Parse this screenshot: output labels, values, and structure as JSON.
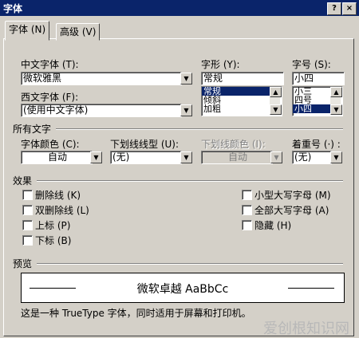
{
  "window": {
    "title": "字体"
  },
  "title_buttons": {
    "help": "?",
    "close": "×"
  },
  "tabs": [
    {
      "label": "字体 (N)"
    },
    {
      "label": "高级 (V)"
    }
  ],
  "fonts": {
    "chinese_label": "中文字体 (T):",
    "chinese_value": "微软雅黑",
    "western_label": "西文字体 (F):",
    "western_value": "(使用中文字体)"
  },
  "style": {
    "label": "字形 (Y):",
    "value": "常规",
    "options": [
      "常规",
      "倾斜",
      "加粗"
    ],
    "selected_index": 0
  },
  "size": {
    "label": "字号 (S):",
    "value": "小四",
    "options": [
      "小三",
      "四号",
      "小四"
    ],
    "selected_index": 2
  },
  "all_text": {
    "section_label": "所有文字",
    "color_label": "字体颜色 (C):",
    "color_value": "自动",
    "underline_label": "下划线线型 (U):",
    "underline_value": "(无)",
    "underline_color_label": "下划线颜色 (I):",
    "underline_color_value": "自动",
    "emphasis_label": "着重号 (·) :",
    "emphasis_value": "(无)"
  },
  "effects": {
    "section_label": "效果",
    "left": [
      {
        "label": "删除线 (K)"
      },
      {
        "label": "双删除线 (L)"
      },
      {
        "label": "上标 (P)"
      },
      {
        "label": "下标 (B)"
      }
    ],
    "right": [
      {
        "label": "小型大写字母 (M)"
      },
      {
        "label": "全部大写字母 (A)"
      },
      {
        "label": "隐藏 (H)"
      }
    ]
  },
  "preview": {
    "section_label": "预览",
    "sample": "微软卓越  AaBbCc",
    "note": "这是一种 TrueType 字体，同时适用于屏幕和打印机。"
  },
  "watermark": "爱创根知识网",
  "colors": {
    "titlebar": "#0a246a",
    "dialog": "#d4d0c8",
    "selection": "#0a246a"
  }
}
